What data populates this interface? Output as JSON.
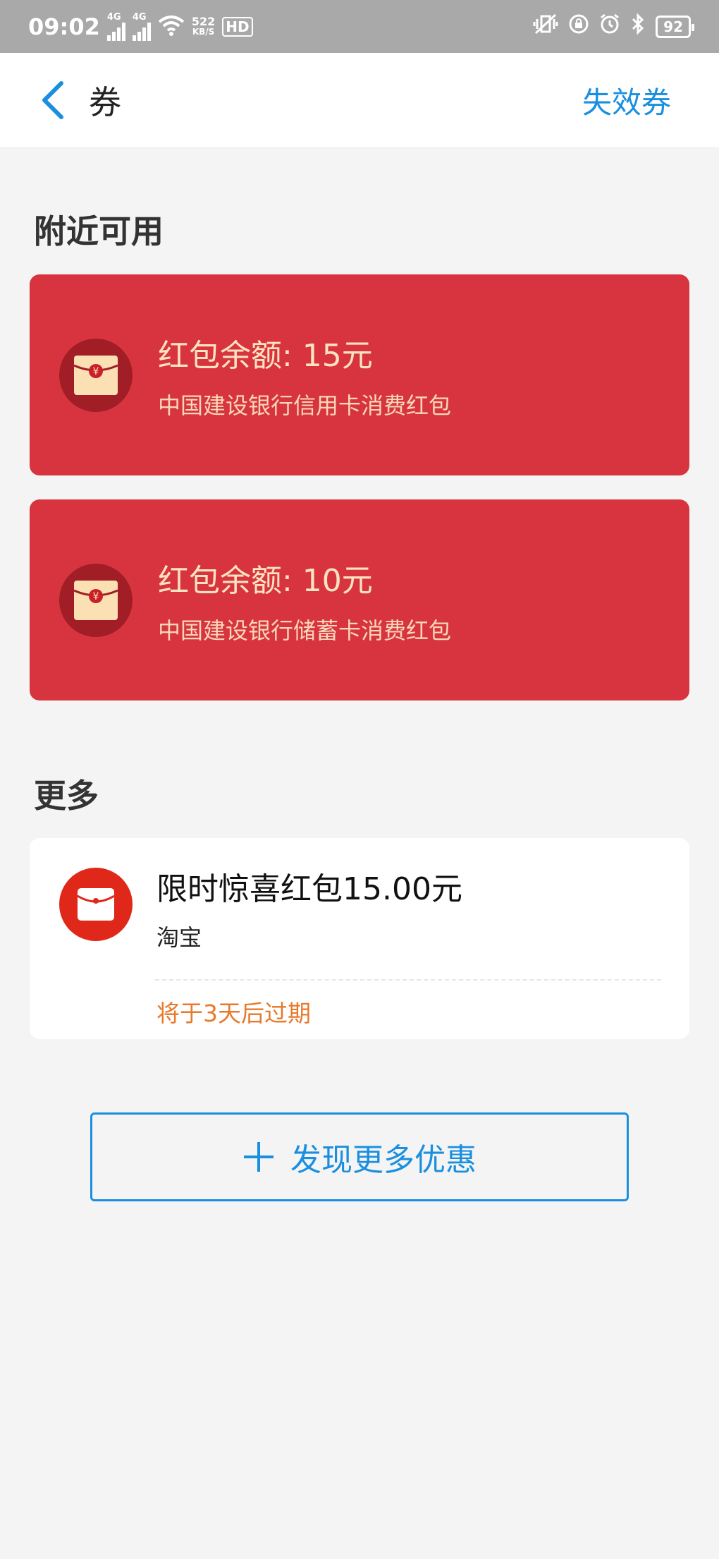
{
  "status_bar": {
    "time": "09:02",
    "net_top": "4G",
    "net_speed_value": "522",
    "net_speed_unit": "KB/S",
    "hd_label": "HD",
    "battery": "92"
  },
  "header": {
    "title": "券",
    "action_label": "失效券"
  },
  "nearby": {
    "title": "附近可用",
    "coupons": [
      {
        "amount": "红包余额: 15元",
        "desc": "中国建设银行信用卡消费红包"
      },
      {
        "amount": "红包余额: 10元",
        "desc": "中国建设银行储蓄卡消费红包"
      }
    ]
  },
  "more": {
    "title": "更多",
    "item": {
      "title": "限时惊喜红包15.00元",
      "source": "淘宝",
      "expire": "将于3天后过期"
    }
  },
  "discover_button": {
    "label": "发现更多优惠"
  },
  "colors": {
    "accent": "#1a8fe0",
    "coupon_red": "#d73440",
    "expire_orange": "#e8782a"
  }
}
